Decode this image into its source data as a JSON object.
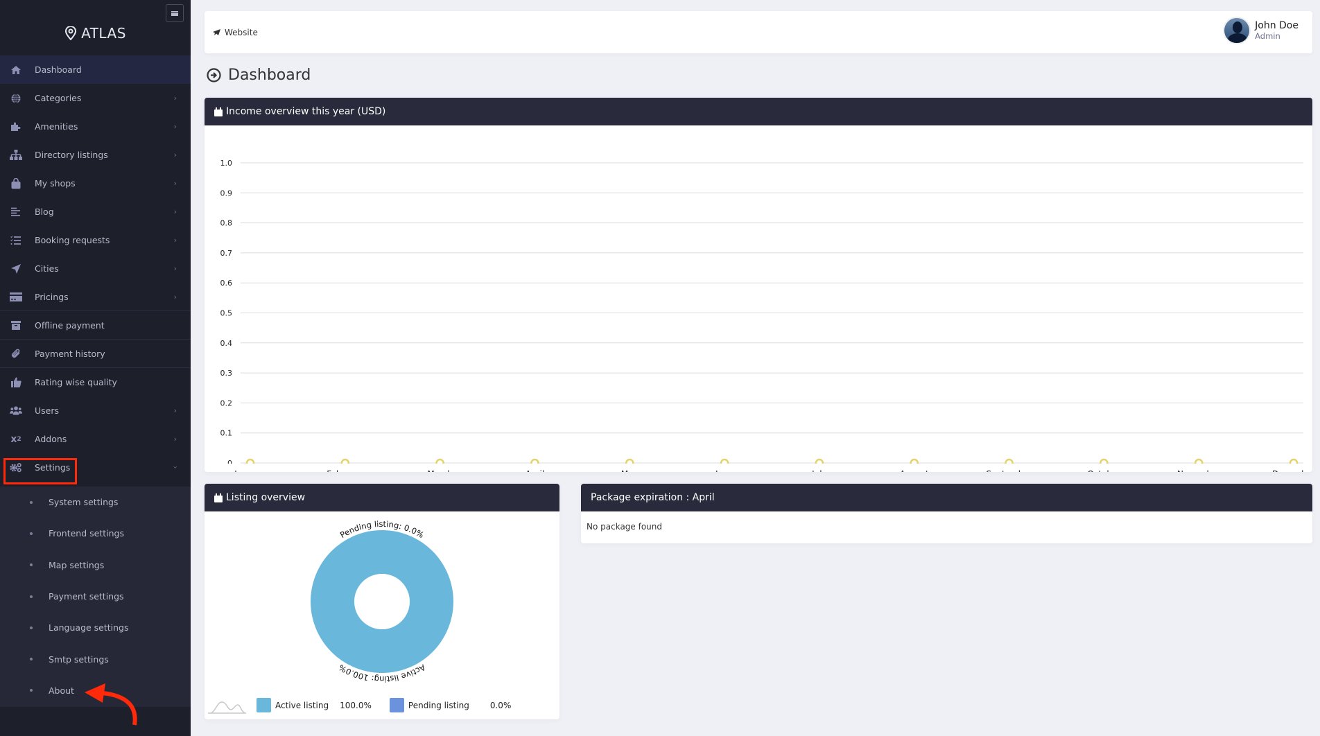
{
  "sidebar": {
    "brand": "ATLAS",
    "menu_toggle_icon": "hamburger-icon",
    "items": [
      {
        "label": "Dashboard",
        "icon": "home-icon",
        "has_submenu": false,
        "active": true
      },
      {
        "label": "Categories",
        "icon": "globe-icon",
        "has_submenu": true
      },
      {
        "label": "Amenities",
        "icon": "puzzle-icon",
        "has_submenu": true
      },
      {
        "label": "Directory listings",
        "icon": "sitemap-icon",
        "has_submenu": true
      },
      {
        "label": "My shops",
        "icon": "shopping-bag-icon",
        "has_submenu": true
      },
      {
        "label": "Blog",
        "icon": "align-left-icon",
        "has_submenu": true
      },
      {
        "label": "Booking requests",
        "icon": "tasks-icon",
        "has_submenu": true
      },
      {
        "label": "Cities",
        "icon": "location-arrow-icon",
        "has_submenu": true
      },
      {
        "label": "Pricings",
        "icon": "credit-card-icon",
        "has_submenu": true
      },
      {
        "label": "Offline payment",
        "icon": "archive-icon",
        "has_submenu": false
      },
      {
        "label": "Payment history",
        "icon": "paperclip-icon",
        "has_submenu": false
      },
      {
        "label": "Rating wise quality",
        "icon": "thumbs-up-icon",
        "has_submenu": false
      },
      {
        "label": "Users",
        "icon": "users-icon",
        "has_submenu": true
      },
      {
        "label": "Addons",
        "icon": "superscript-icon",
        "has_submenu": true
      },
      {
        "label": "Settings",
        "icon": "cogs-icon",
        "has_submenu": true,
        "expanded": true,
        "highlighted": true
      }
    ],
    "settings_submenu": [
      {
        "label": "System settings"
      },
      {
        "label": "Frontend settings"
      },
      {
        "label": "Map settings"
      },
      {
        "label": "Payment settings"
      },
      {
        "label": "Language settings"
      },
      {
        "label": "Smtp settings"
      },
      {
        "label": "About"
      }
    ],
    "annotation_color": "#ff2a0a"
  },
  "topbar": {
    "website_label": "Website",
    "user": {
      "name": "John Doe",
      "role": "Admin"
    }
  },
  "page": {
    "title": "Dashboard"
  },
  "income_card": {
    "title": "Income overview this year (USD)"
  },
  "listing_card": {
    "title": "Listing overview"
  },
  "package_card": {
    "title": "Package expiration : April",
    "empty_text": "No package found"
  },
  "colors": {
    "sidebar_bg": "#1d1f2b",
    "card_header_bg": "#292b3c",
    "page_bg": "#eef0f5"
  },
  "chart_data": [
    {
      "type": "line",
      "title": "Income overview this year (USD)",
      "categories": [
        "January",
        "February",
        "March",
        "April",
        "May",
        "June",
        "July",
        "August",
        "September",
        "October",
        "November",
        "December"
      ],
      "series": [
        {
          "name": "Income",
          "values": [
            0,
            0,
            0,
            0,
            0,
            0,
            0,
            0,
            0,
            0,
            0,
            0
          ]
        }
      ],
      "ylim": [
        0,
        1.0
      ],
      "yticks": [
        "0",
        "0.1",
        "0.2",
        "0.3",
        "0.4",
        "0.5",
        "0.6",
        "0.7",
        "0.8",
        "0.9",
        "1.0"
      ],
      "grid": true,
      "xlabel": "",
      "ylabel": ""
    },
    {
      "type": "pie",
      "variant": "donut",
      "title": "Listing overview",
      "slices": [
        {
          "label": "Active listing",
          "value": 100.0,
          "display": "100.0%",
          "color": "#69b8dc",
          "outer_label": "Active listing: 100.0%"
        },
        {
          "label": "Pending listing",
          "value": 0.0,
          "display": "0.0%",
          "color": "#6b93dd",
          "outer_label": "Pending listing: 0.0%"
        }
      ],
      "legend": "bottom"
    }
  ]
}
